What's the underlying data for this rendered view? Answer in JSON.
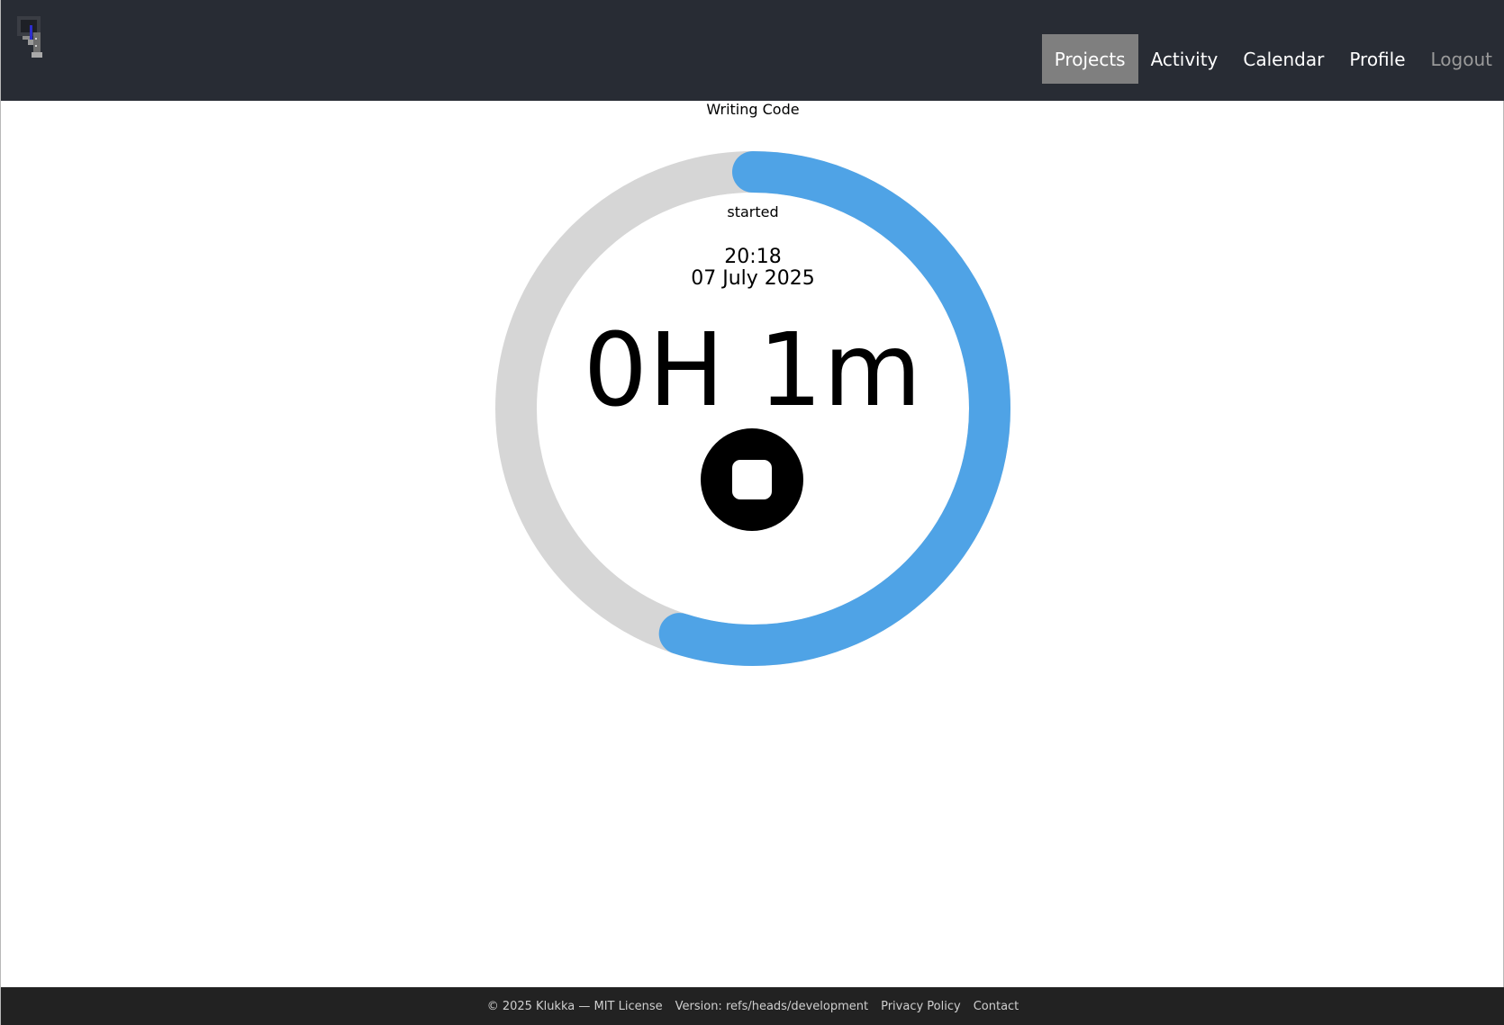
{
  "nav": {
    "items": [
      {
        "label": "Projects",
        "active": true
      },
      {
        "label": "Activity"
      },
      {
        "label": "Calendar"
      },
      {
        "label": "Profile"
      },
      {
        "label": "Logout",
        "muted": true
      }
    ]
  },
  "timer": {
    "project": "Writing Code",
    "started_label": "started",
    "start_time": "20:18",
    "start_date": "07 July 2025",
    "elapsed": "0H 1m",
    "progress": 0.55,
    "progress_color": "#4fa3e6",
    "track_color": "#d6d6d6",
    "stop_icon": "stop-icon"
  },
  "footer": {
    "copyright": "© 2025 Klukka — MIT License",
    "version": "Version: refs/heads/development",
    "privacy": "Privacy Policy",
    "contact": "Contact"
  },
  "colors": {
    "navbar_bg": "#282c34",
    "active_nav_bg": "#7f7f7f",
    "footer_bg": "#222222"
  }
}
